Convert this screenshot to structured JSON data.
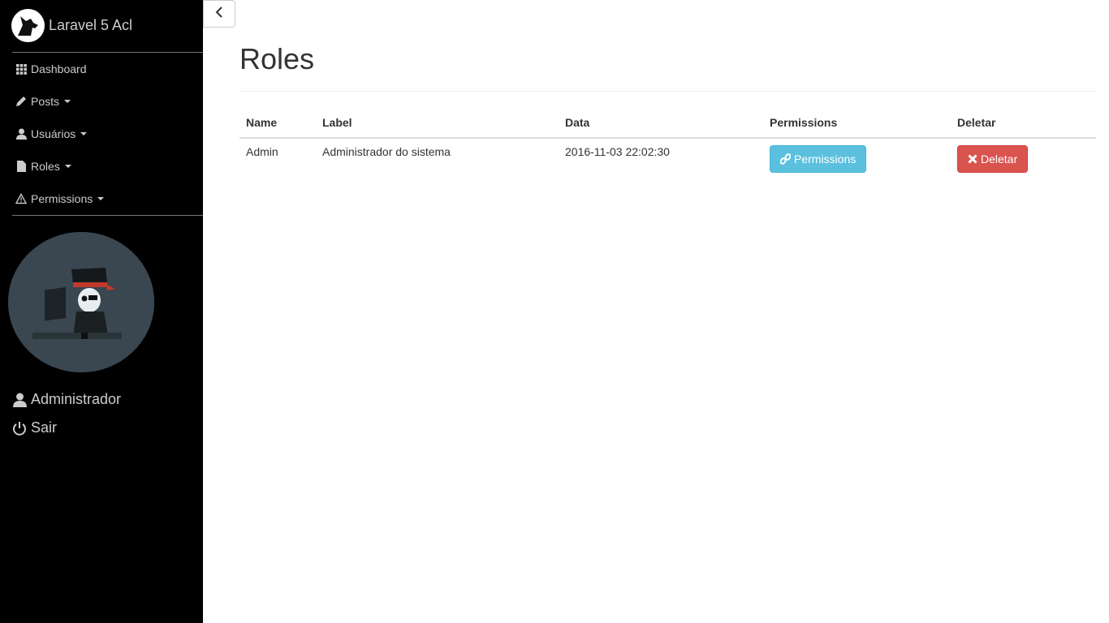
{
  "sidebar": {
    "brand": "Laravel 5 Acl",
    "items": [
      {
        "label": "Dashboard",
        "icon": "grid-icon",
        "has_caret": false
      },
      {
        "label": "Posts",
        "icon": "pencil-icon",
        "has_caret": true
      },
      {
        "label": "Usuários",
        "icon": "user-icon",
        "has_caret": true
      },
      {
        "label": "Roles",
        "icon": "file-icon",
        "has_caret": true
      },
      {
        "label": "Permissions",
        "icon": "warning-icon",
        "has_caret": true
      }
    ],
    "user_name": "Administrador",
    "logout_label": "Sair"
  },
  "main": {
    "title": "Roles",
    "table": {
      "headers": [
        "Name",
        "Label",
        "Data",
        "Permissions",
        "Deletar"
      ],
      "rows": [
        {
          "name": "Admin",
          "label": "Administrador do sistema",
          "date": "2016-11-03 22:02:30",
          "permissions_btn": "Permissions",
          "delete_btn": "Deletar"
        }
      ]
    }
  },
  "colors": {
    "sidebar_bg": "#000000",
    "info": "#5bc0de",
    "danger": "#d9534f"
  }
}
